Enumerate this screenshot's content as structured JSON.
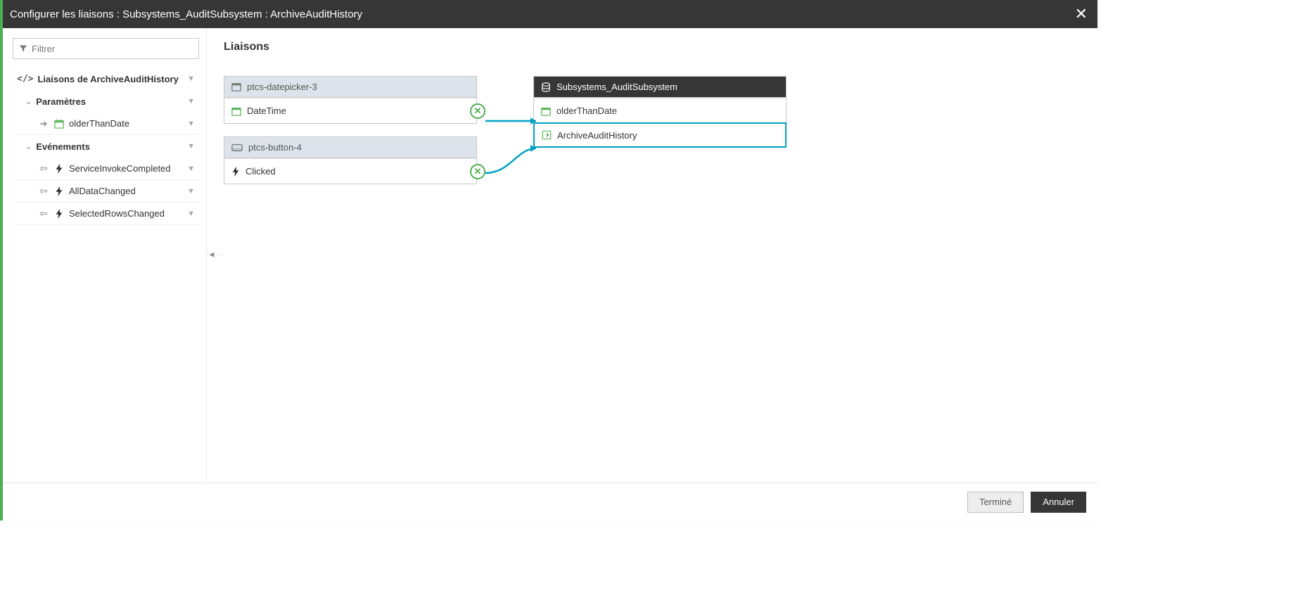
{
  "header": {
    "title": "Configurer les liaisons : Subsystems_AuditSubsystem : ArchiveAuditHistory"
  },
  "sidebar": {
    "filter_placeholder": "Filtrer",
    "root_label": "Liaisons de ArchiveAuditHistory",
    "sections": {
      "params": {
        "label": "Paramètres",
        "items": [
          {
            "label": "olderThanDate"
          }
        ]
      },
      "events": {
        "label": "Evénements",
        "items": [
          {
            "label": "ServiceInvokeCompleted"
          },
          {
            "label": "AllDataChanged"
          },
          {
            "label": "SelectedRowsChanged"
          }
        ]
      }
    }
  },
  "main": {
    "heading": "Liaisons",
    "left_nodes": [
      {
        "header": "ptcs-datepicker-3",
        "ports": [
          {
            "label": "DateTime",
            "icon": "calendar"
          }
        ]
      },
      {
        "header": "ptcs-button-4",
        "ports": [
          {
            "label": "Clicked",
            "icon": "bolt"
          }
        ]
      }
    ],
    "right_node": {
      "header": "Subsystems_AuditSubsystem",
      "ports": [
        {
          "label": "olderThanDate",
          "icon": "calendar",
          "selected": false
        },
        {
          "label": "ArchiveAuditHistory",
          "icon": "service",
          "selected": true
        }
      ]
    }
  },
  "footer": {
    "done": "Terminé",
    "cancel": "Annuler"
  }
}
